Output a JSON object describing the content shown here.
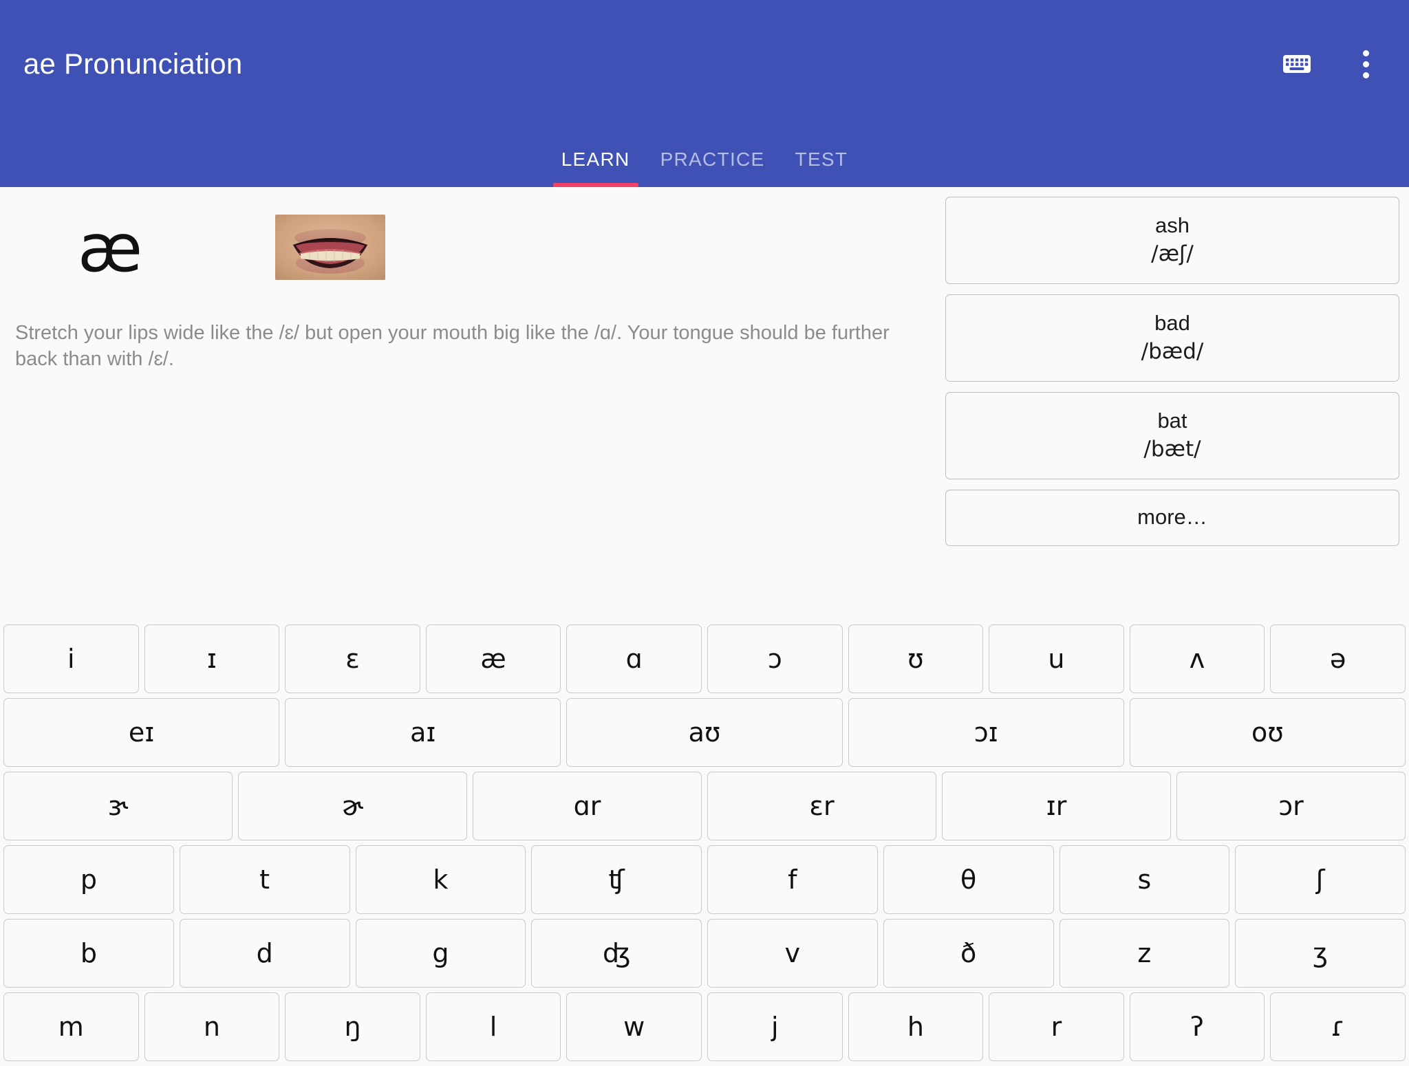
{
  "app": {
    "title": "ae Pronunciation",
    "header_color": "#3f51b5",
    "accent_color": "#f2416b",
    "background_color": "#fafafa"
  },
  "actions": {
    "keyboard_icon": "keyboard-icon",
    "overflow_icon": "more-vert-icon"
  },
  "tabs": [
    {
      "label": "LEARN",
      "active": true
    },
    {
      "label": "PRACTICE",
      "active": false
    },
    {
      "label": "TEST",
      "active": false
    }
  ],
  "lesson": {
    "symbol": "æ",
    "mouth_image_alt": "mouth-articulation-photo",
    "description": "Stretch your lips wide like the /ɛ/ but open your mouth big like the /ɑ/. Your tongue should be further back than with /ɛ/."
  },
  "words": [
    {
      "word": "ash",
      "ipa": "/æʃ/"
    },
    {
      "word": "bad",
      "ipa": "/bæd/"
    },
    {
      "word": "bat",
      "ipa": "/bæt/"
    }
  ],
  "more_label": "more…",
  "keyboard": {
    "rows": [
      {
        "keys": [
          "i",
          "ɪ",
          "ɛ",
          "æ",
          "ɑ",
          "ɔ",
          "ʊ",
          "u",
          "ʌ",
          "ə"
        ]
      },
      {
        "keys": [
          "eɪ",
          "aɪ",
          "aʊ",
          "ɔɪ",
          "oʊ"
        ]
      },
      {
        "keys": [
          "ɝ",
          "ɚ",
          "ɑr",
          "ɛr",
          "ɪr",
          "ɔr"
        ]
      },
      {
        "keys": [
          "p",
          "t",
          "k",
          "ʧ",
          "f",
          "θ",
          "s",
          "ʃ"
        ]
      },
      {
        "keys": [
          "b",
          "d",
          "g",
          "ʤ",
          "v",
          "ð",
          "z",
          "ʒ"
        ]
      },
      {
        "keys": [
          "m",
          "n",
          "ŋ",
          "l",
          "w",
          "j",
          "h",
          "r",
          "ʔ",
          "ɾ"
        ]
      }
    ]
  }
}
